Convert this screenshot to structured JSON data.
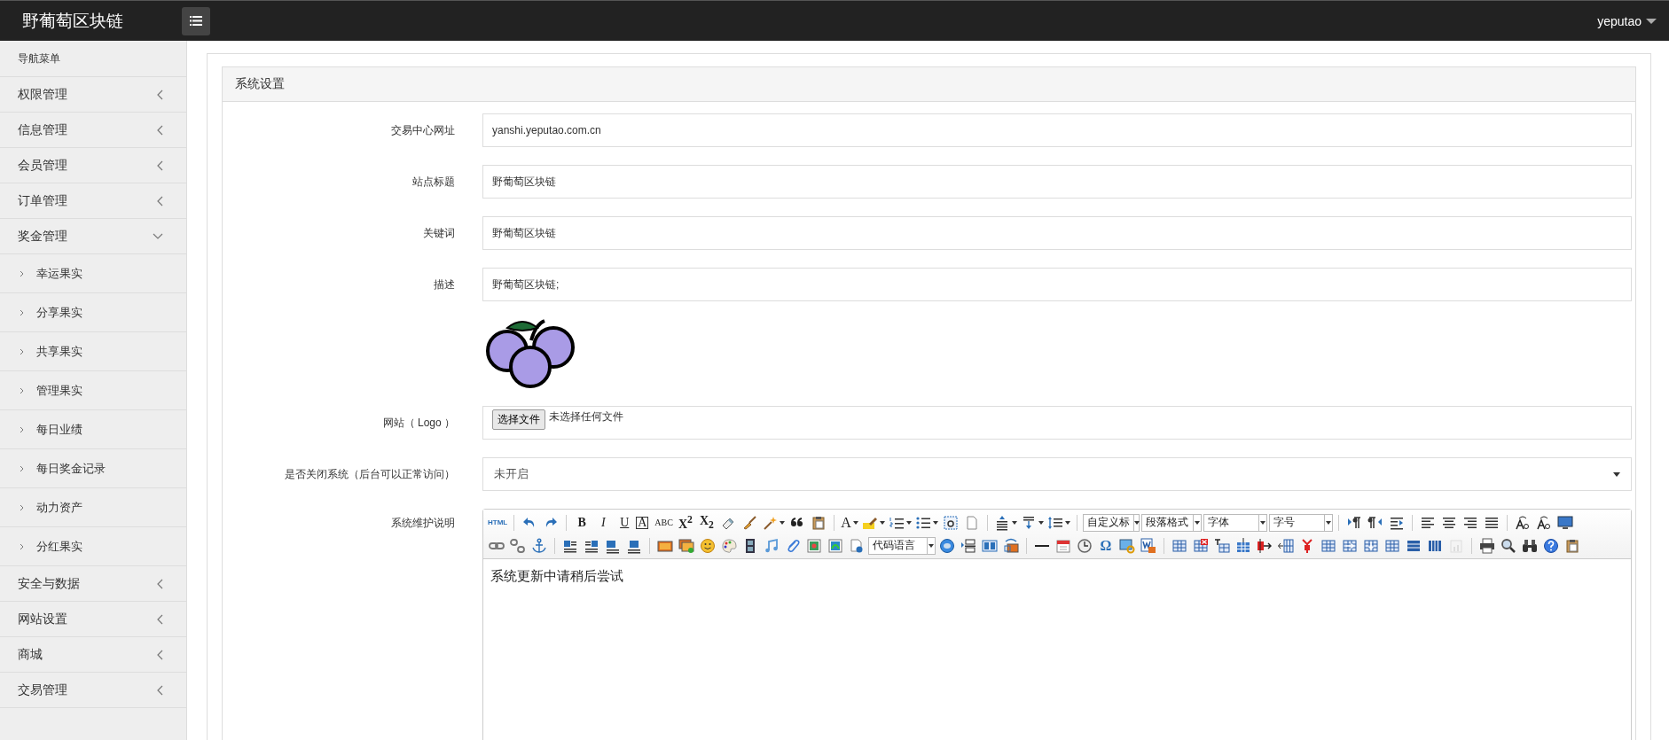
{
  "header": {
    "brand": "野葡萄区块链",
    "user": "yeputao"
  },
  "sidebar": {
    "title": "导航菜单",
    "items": [
      {
        "label": "权限管理",
        "expanded": false
      },
      {
        "label": "信息管理",
        "expanded": false
      },
      {
        "label": "会员管理",
        "expanded": false
      },
      {
        "label": "订单管理",
        "expanded": false
      },
      {
        "label": "奖金管理",
        "expanded": true,
        "children": [
          {
            "label": "幸运果实"
          },
          {
            "label": "分享果实"
          },
          {
            "label": "共享果实"
          },
          {
            "label": "管理果实"
          },
          {
            "label": "每日业绩"
          },
          {
            "label": "每日奖金记录"
          },
          {
            "label": "动力资产"
          },
          {
            "label": "分红果实"
          }
        ]
      },
      {
        "label": "安全与数据",
        "expanded": false
      },
      {
        "label": "网站设置",
        "expanded": false
      },
      {
        "label": "商城",
        "expanded": false
      },
      {
        "label": "交易管理",
        "expanded": false
      }
    ]
  },
  "panel": {
    "title": "系统设置",
    "fields": [
      {
        "kind": "text",
        "label": "交易中心网址",
        "value": "yanshi.yeputao.com.cn"
      },
      {
        "kind": "text",
        "label": "站点标题",
        "value": "野葡萄区块链"
      },
      {
        "kind": "text",
        "label": "关键词",
        "value": "野葡萄区块链"
      },
      {
        "kind": "text",
        "label": "描述",
        "value": "野葡萄区块链;"
      },
      {
        "kind": "image"
      },
      {
        "kind": "file",
        "label": "网站（ Logo ）",
        "button": "选择文件",
        "value": "未选择任何文件"
      },
      {
        "kind": "select",
        "label": "是否关闭系统（后台可以正常访问）",
        "value": "未开启"
      },
      {
        "kind": "editor",
        "label": "系统维护说明",
        "content": "系统更新中请稍后尝试",
        "toolbar_texts": [
          "HTML",
          "B",
          "I",
          "U",
          "A",
          "ABC",
          "X$^{2}$",
          "X$_{2}$",
          "A",
          "Ω"
        ],
        "toolbar_selects": [
          "自定义标",
          "段落格式",
          "字体",
          "字号",
          "代码语言"
        ]
      }
    ]
  }
}
